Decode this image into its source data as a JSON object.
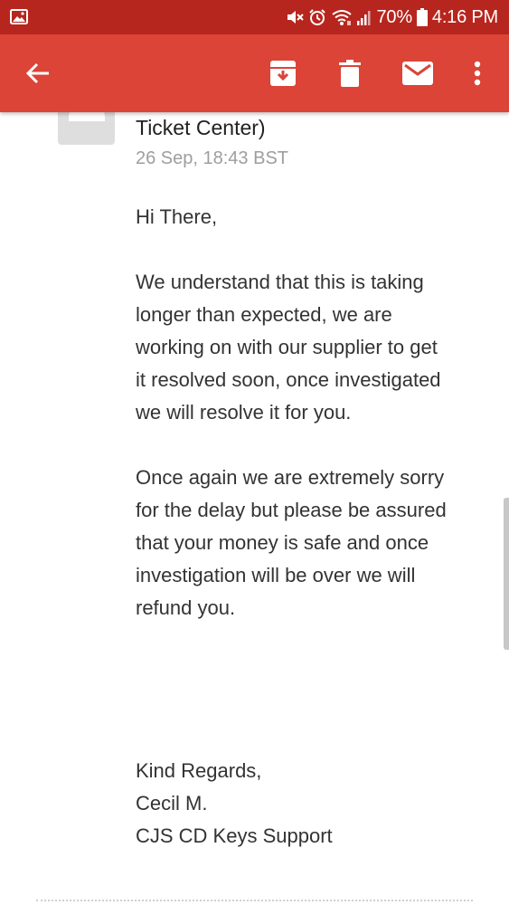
{
  "status_bar": {
    "battery_percent": "70%",
    "time": "4:16 PM",
    "icons": [
      "gallery-icon",
      "mute-icon",
      "alarm-icon",
      "wifi-icon",
      "signal-icon",
      "battery-icon"
    ]
  },
  "app_bar": {
    "actions": [
      "back-arrow-icon",
      "archive-icon",
      "delete-icon",
      "mark-unread-icon",
      "more-options-icon"
    ],
    "color": "#db4437"
  },
  "message": {
    "sender_line": "Ticket Center)",
    "date": "26 Sep, 18:43 BST",
    "greeting": "Hi There,",
    "paragraph1": [
      "We understand that this is taking",
      "longer than expected, we are",
      "working on with our supplier to get",
      "it resolved soon, once investigated",
      "we will resolve it for you."
    ],
    "paragraph2": [
      "Once again we are extremely sorry",
      "for the delay but please be assured",
      "that your money is safe and once",
      "investigation will be over we will",
      "refund you."
    ],
    "signature": [
      "Kind Regards,",
      "Cecil M.",
      "CJS CD Keys Support"
    ]
  }
}
